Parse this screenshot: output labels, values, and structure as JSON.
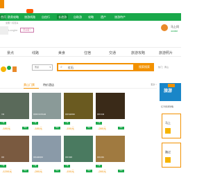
{
  "navbar": {
    "items": [
      "首页",
      "欧贵攻略",
      "旅游线路",
      "自由行",
      "长途游",
      "自助游",
      "攻略",
      "遗产",
      "旅游特产"
    ]
  },
  "header": {
    "crumb": "全国 > 红石头",
    "site_name": "Longhe",
    "tag": "已认证 >",
    "side_label": "马上问",
    "side_sub": "400888"
  },
  "categories": [
    "景点",
    "线路",
    "美食",
    "住宿",
    "交通",
    "旅游攻略",
    "旅游照片"
  ],
  "search": {
    "select_label": "景点",
    "input_value": "红石",
    "button_label": "搜索搜索",
    "hot_label": "热门：黄山"
  },
  "tabs": {
    "active": "黄山门票",
    "other": "特价酒店",
    "more": "更多 >"
  },
  "cards": [
    {
      "caption": "中国",
      "price": "-180元"
    },
    {
      "caption": "某某地方标志性山峰",
      "price": "-180元"
    },
    {
      "caption": "某某寺庙旅游区",
      "price": "-150元"
    },
    {
      "caption": "某地方石窟",
      "price": "-280元"
    },
    {
      "caption": "某某",
      "price": "-1200元"
    },
    {
      "caption": "某某山峰风景区",
      "price": "-280元"
    },
    {
      "caption": "某地方园林",
      "price": "-150元"
    },
    {
      "caption": "某某大瀑布",
      "price": "-280元"
    }
  ],
  "card_pill": "门票",
  "card_pill2": "购买",
  "sidebar": {
    "promo_title": "旅游",
    "caption": "红湾旅游攻略",
    "card1": "马上",
    "card2": "路过"
  },
  "colors": {
    "brand_green": "#19a84a",
    "accent_orange": "#f29100"
  }
}
